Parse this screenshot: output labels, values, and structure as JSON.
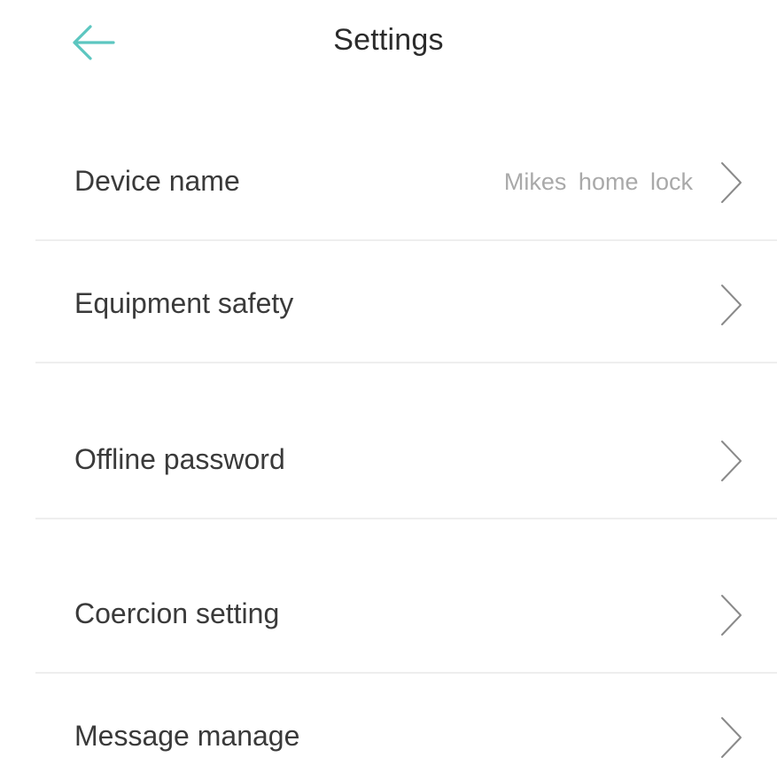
{
  "header": {
    "title": "Settings",
    "back_icon": "arrow-left-icon",
    "accent_color": "#5cc6c0"
  },
  "settings": {
    "items": [
      {
        "label": "Device name",
        "value": "Mikes  home lock",
        "icon": "chevron-right-icon"
      },
      {
        "label": "Equipment safety",
        "icon": "chevron-right-icon"
      },
      {
        "label": "Offline password",
        "icon": "chevron-right-icon"
      },
      {
        "label": "Coercion setting",
        "icon": "chevron-right-icon"
      },
      {
        "label": "Message manage",
        "icon": "chevron-right-icon"
      }
    ]
  }
}
